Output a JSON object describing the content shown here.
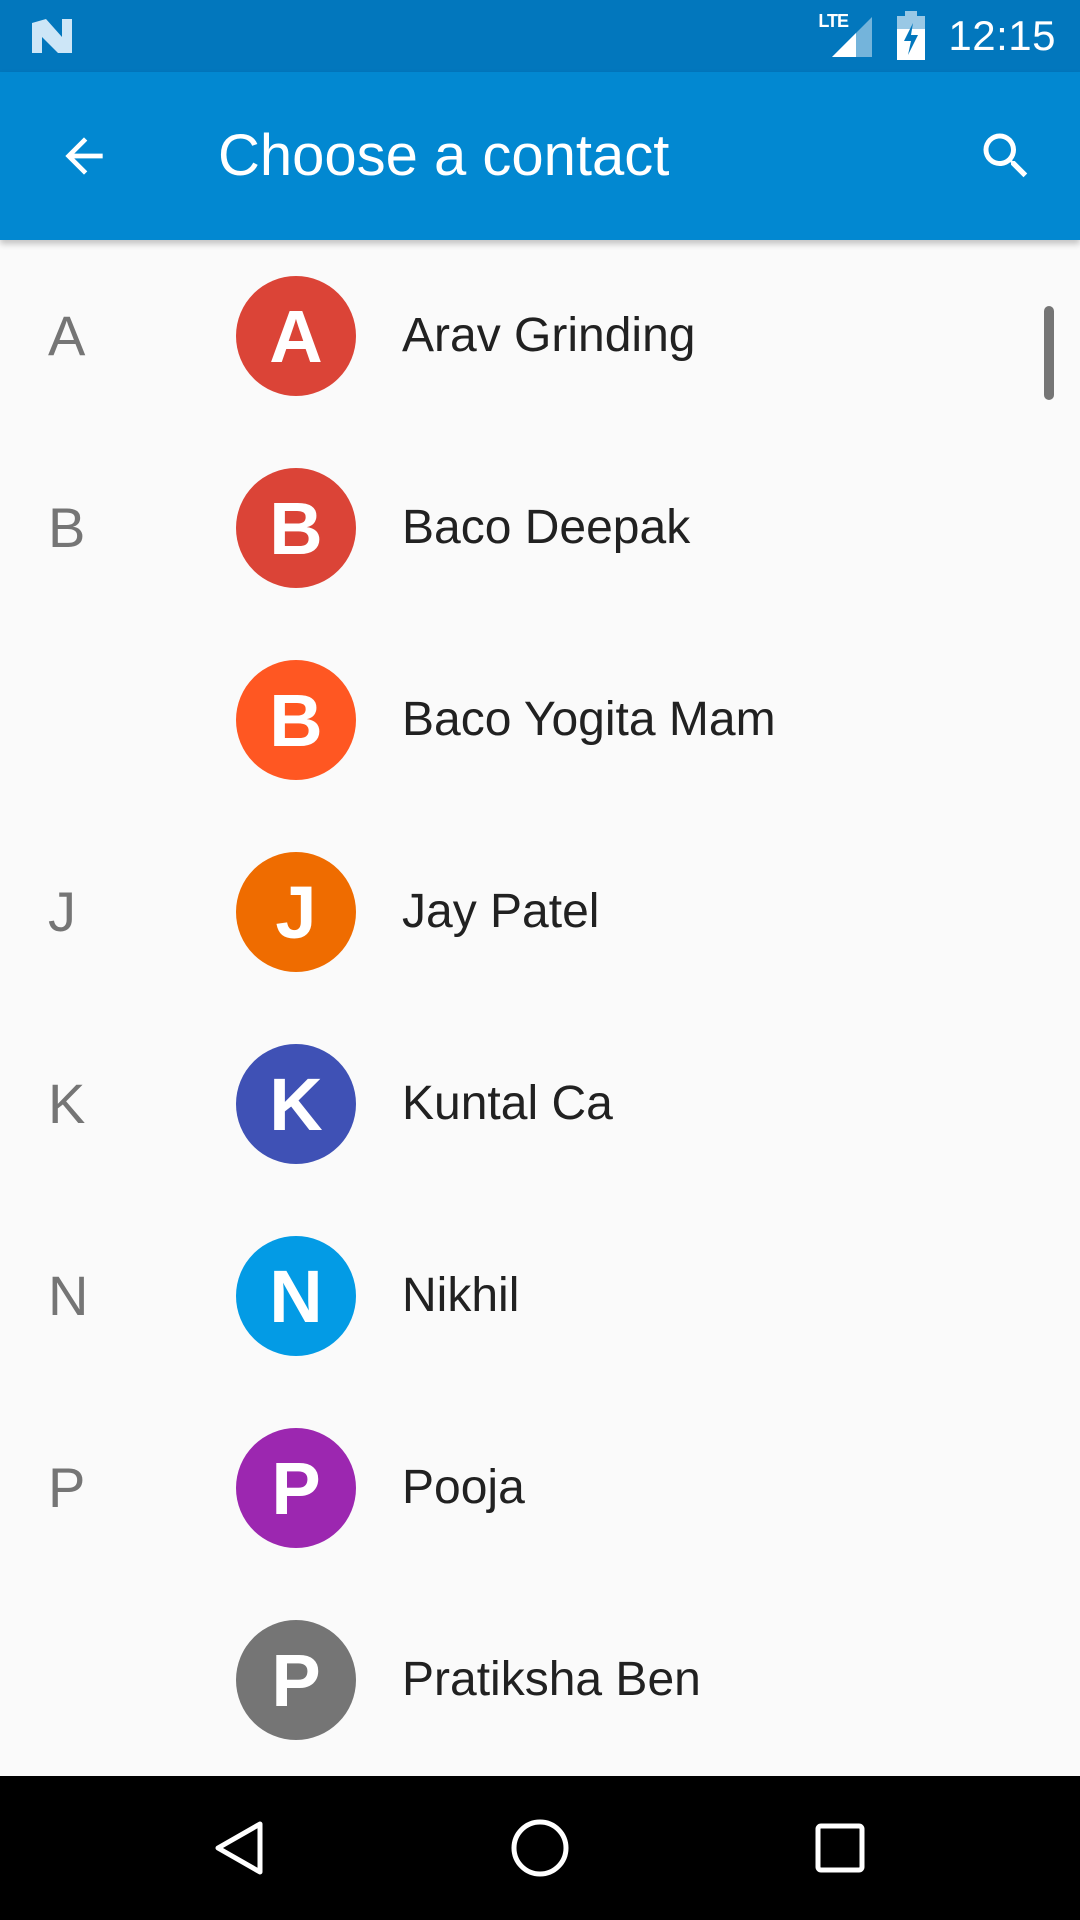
{
  "status_bar": {
    "time": "12:15",
    "network_label": "LTE",
    "icons": [
      "notification-n-icon",
      "lte-signal-icon",
      "battery-charging-icon"
    ]
  },
  "app_bar": {
    "title": "Choose a contact",
    "back_icon": "arrow-back-icon",
    "search_icon": "search-icon",
    "color": "#0288d1",
    "status_color": "#0277bd"
  },
  "contacts": [
    {
      "section": "A",
      "initial": "A",
      "name": "Arav Grinding",
      "color": "#db4437"
    },
    {
      "section": "B",
      "initial": "B",
      "name": "Baco Deepak",
      "color": "#db4437"
    },
    {
      "section": "",
      "initial": "B",
      "name": "Baco Yogita Mam",
      "color": "#ff5722"
    },
    {
      "section": "J",
      "initial": "J",
      "name": "Jay Patel",
      "color": "#ef6c00"
    },
    {
      "section": "K",
      "initial": "K",
      "name": "Kuntal Ca",
      "color": "#3f51b5"
    },
    {
      "section": "N",
      "initial": "N",
      "name": "Nikhil",
      "color": "#039be5"
    },
    {
      "section": "P",
      "initial": "P",
      "name": "Pooja",
      "color": "#9c27b0"
    },
    {
      "section": "",
      "initial": "P",
      "name": "Pratiksha Ben",
      "color": "#757575"
    }
  ],
  "nav_bar": {
    "icons": [
      "back-triangle-icon",
      "home-circle-icon",
      "recents-square-icon"
    ]
  }
}
